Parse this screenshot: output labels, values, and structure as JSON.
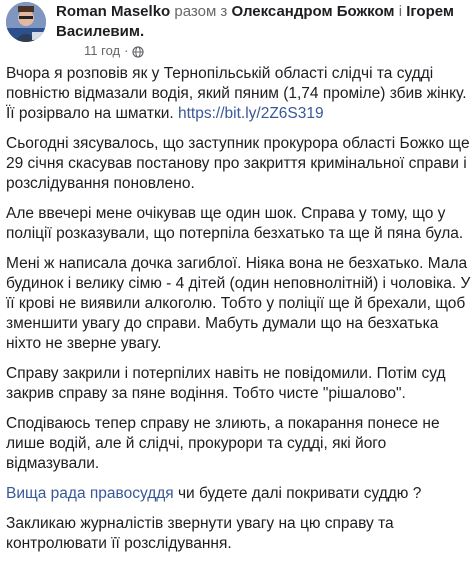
{
  "header": {
    "author": "Roman Maselko",
    "with_text": "разом з",
    "tagged_1": "Олександром Божком",
    "and_text": "і",
    "tagged_2": "Ігорем Василевим.",
    "timestamp": "11 год",
    "dot": "·",
    "privacy_icon": "globe-icon"
  },
  "post": {
    "p1_text": "Вчора я розповів як у Тернопільській області слідчі та судді повністю відмазали водія, який пяним (1,74 проміле) збив жінку. Її розірвало на шматки. ",
    "p1_link": "https://bit.ly/2Z6S319",
    "p2": "Сьогодні зясувалось, що заступник прокурора області Божко ще 29 січня скасував постанову про закриття кримінальної справи і розслідування поновлено.",
    "p3": "Але ввечері мене очікував ще один шок. Справа у тому, що у поліції розказували, що потерпіла безхатько та ще й пяна була.",
    "p4": "Мені ж написала дочка загиблої. Ніяка вона не безхатько. Мала будинок і велику сімю - 4 дітей (один неповнолітній) і чоловіка. У її крові не виявили алкоголю. Тобто у поліції ще й брехали, щоб зменшити увагу до справи. Мабуть думали що на безхатька ніхто не зверне увагу.",
    "p5": "Справу закрили і потерпілих навіть не повідомили. Потім суд закрив справу за пяне водіння. Тобто чисте \"рішалово\".",
    "p6": "Сподіваюсь тепер справу не злиють, а покарання понесе не лише водій, але й слідчі, прокурори та судді, які його відмазували.",
    "p7_link": "Вища рада правосуддя",
    "p7_text": " чи будете далі покривати суддю ?",
    "p8": "Закликаю журналістів звернути увагу на цю справу та контролювати її розслідування."
  },
  "colors": {
    "text": "#1c1e21",
    "muted": "#65676b",
    "link": "#385898"
  }
}
